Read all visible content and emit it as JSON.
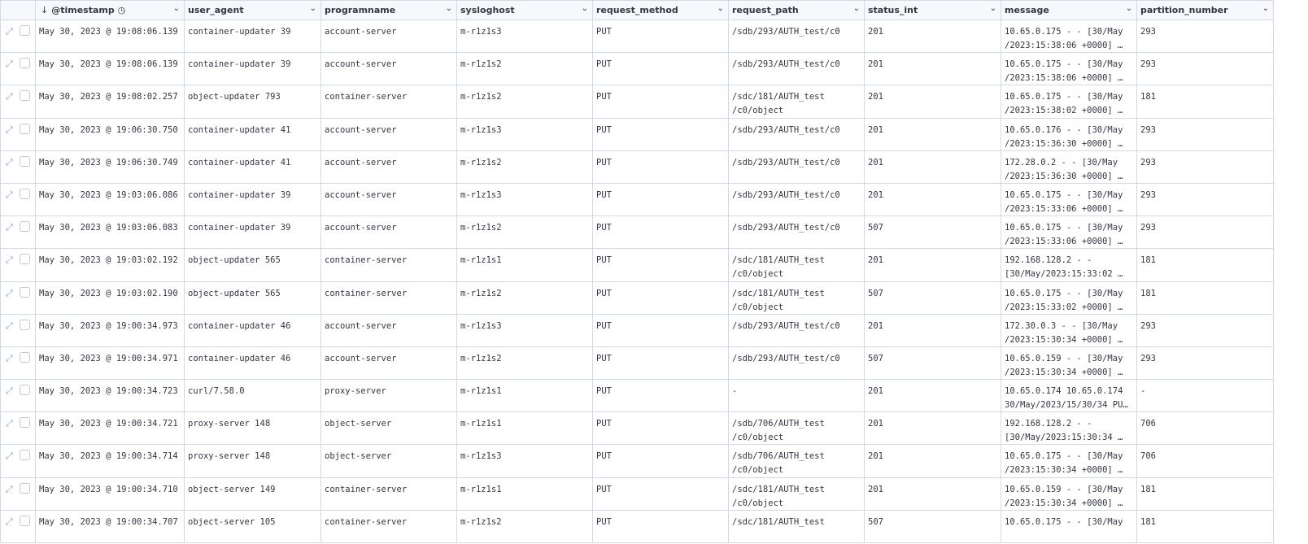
{
  "columns": [
    "@timestamp",
    "user_agent",
    "programname",
    "sysloghost",
    "request_method",
    "request_path",
    "status_int",
    "message",
    "partition_number"
  ],
  "rows": [
    [
      "May 30, 2023 @ 19:08:06.139",
      "container-updater 39",
      "account-server",
      "m-r1z1s3",
      "PUT",
      "/sdb/293/AUTH_test/c0",
      "",
      "201",
      " 10.65.0.175 - - [30/May",
      "/2023:15:38:06 +0000] …",
      "293"
    ],
    [
      "May 30, 2023 @ 19:08:06.139",
      "container-updater 39",
      "account-server",
      "m-r1z1s2",
      "PUT",
      "/sdb/293/AUTH_test/c0",
      "",
      "201",
      " 10.65.0.175 - - [30/May",
      "/2023:15:38:06 +0000] …",
      "293"
    ],
    [
      "May 30, 2023 @ 19:08:02.257",
      "object-updater 793",
      "container-server",
      "m-r1z1s2",
      "PUT",
      "/sdc/181/AUTH_test",
      "/c0/object",
      "201",
      " 10.65.0.175 - - [30/May",
      "/2023:15:38:02 +0000] …",
      "181"
    ],
    [
      "May 30, 2023 @ 19:06:30.750",
      "container-updater 41",
      "account-server",
      "m-r1z1s3",
      "PUT",
      "/sdb/293/AUTH_test/c0",
      "",
      "201",
      " 10.65.0.176 - - [30/May",
      "/2023:15:36:30 +0000] …",
      "293"
    ],
    [
      "May 30, 2023 @ 19:06:30.749",
      "container-updater 41",
      "account-server",
      "m-r1z1s2",
      "PUT",
      "/sdb/293/AUTH_test/c0",
      "",
      "201",
      " 172.28.0.2 - - [30/May",
      "/2023:15:36:30 +0000] …",
      "293"
    ],
    [
      "May 30, 2023 @ 19:03:06.086",
      "container-updater 39",
      "account-server",
      "m-r1z1s3",
      "PUT",
      "/sdb/293/AUTH_test/c0",
      "",
      "201",
      " 10.65.0.175 - - [30/May",
      "/2023:15:33:06 +0000] …",
      "293"
    ],
    [
      "May 30, 2023 @ 19:03:06.083",
      "container-updater 39",
      "account-server",
      "m-r1z1s2",
      "PUT",
      "/sdb/293/AUTH_test/c0",
      "",
      "507",
      " 10.65.0.175 - - [30/May",
      "/2023:15:33:06 +0000] …",
      "293"
    ],
    [
      "May 30, 2023 @ 19:03:02.192",
      "object-updater 565",
      "container-server",
      "m-r1z1s1",
      "PUT",
      "/sdc/181/AUTH_test",
      "/c0/object",
      "201",
      " 192.168.128.2 - -",
      "[30/May/2023:15:33:02 …",
      "181"
    ],
    [
      "May 30, 2023 @ 19:03:02.190",
      "object-updater 565",
      "container-server",
      "m-r1z1s2",
      "PUT",
      "/sdc/181/AUTH_test",
      "/c0/object",
      "507",
      " 10.65.0.175 - - [30/May",
      "/2023:15:33:02 +0000] …",
      "181"
    ],
    [
      "May 30, 2023 @ 19:00:34.973",
      "container-updater 46",
      "account-server",
      "m-r1z1s3",
      "PUT",
      "/sdb/293/AUTH_test/c0",
      "",
      "201",
      " 172.30.0.3 - - [30/May",
      "/2023:15:30:34 +0000] …",
      "293"
    ],
    [
      "May 30, 2023 @ 19:00:34.971",
      "container-updater 46",
      "account-server",
      "m-r1z1s2",
      "PUT",
      "/sdb/293/AUTH_test/c0",
      "",
      "507",
      " 10.65.0.159 - - [30/May",
      "/2023:15:30:34 +0000] …",
      "293"
    ],
    [
      "May 30, 2023 @ 19:00:34.723",
      "curl/7.58.0",
      "proxy-server",
      "m-r1z1s1",
      "PUT",
      " -",
      "",
      "201",
      " 10.65.0.174 10.65.0.174",
      "30/May/2023/15/30/34 PU…",
      " -"
    ],
    [
      "May 30, 2023 @ 19:00:34.721",
      "proxy-server 148",
      "object-server",
      "m-r1z1s1",
      "PUT",
      "/sdb/706/AUTH_test",
      "/c0/object",
      "201",
      " 192.168.128.2 - -",
      "[30/May/2023:15:30:34 …",
      "706"
    ],
    [
      "May 30, 2023 @ 19:00:34.714",
      "proxy-server 148",
      "object-server",
      "m-r1z1s3",
      "PUT",
      "/sdb/706/AUTH_test",
      "/c0/object",
      "201",
      " 10.65.0.175 - - [30/May",
      "/2023:15:30:34 +0000] …",
      "706"
    ],
    [
      "May 30, 2023 @ 19:00:34.710",
      "object-server 149",
      "container-server",
      "m-r1z1s1",
      "PUT",
      "/sdc/181/AUTH_test",
      "/c0/object",
      "201",
      " 10.65.0.159 - - [30/May",
      "/2023:15:30:34 +0000] …",
      "181"
    ],
    [
      "May 30, 2023 @ 19:00:34.707",
      "object-server 105",
      "container-server",
      "m-r1z1s2",
      "PUT",
      "/sdc/181/AUTH_test",
      "",
      "507",
      " 10.65.0.175 - - [30/May",
      "",
      "181"
    ]
  ]
}
